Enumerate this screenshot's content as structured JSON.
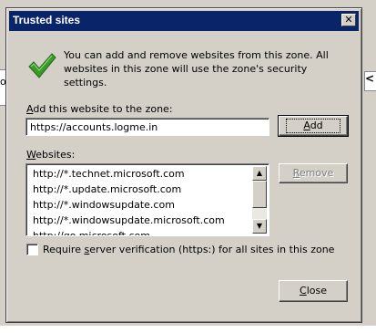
{
  "background": {
    "left_fragment": "o",
    "right_fragment": "<"
  },
  "dialog": {
    "title": "Trusted sites",
    "close_glyph": "✕",
    "intro_text": "You can add and remove websites from this zone. All websites in this zone will use the zone's security settings.",
    "add_label_prefix": "",
    "add_label_key": "A",
    "add_label_rest": "dd this website to the zone:",
    "add_input_value": "https://accounts.logme.in",
    "add_button_key": "A",
    "add_button_rest": "dd",
    "websites_label_key": "W",
    "websites_label_rest": "ebsites:",
    "websites": [
      "http://*.technet.microsoft.com",
      "http://*.update.microsoft.com",
      "http://*.windowsupdate.com",
      "http://*.windowsupdate.microsoft.com",
      "http://go.microsoft.com"
    ],
    "remove_button_key": "R",
    "remove_button_rest": "emove",
    "require_prefix": "Require ",
    "require_key": "s",
    "require_rest": "erver verification (https:) for all sites in this zone",
    "require_checked": false,
    "close_button_key": "C",
    "close_button_rest": "lose"
  },
  "icons": {
    "check": "check-icon",
    "scroll_up": "scroll-up-icon",
    "scroll_down": "scroll-down-icon"
  },
  "colors": {
    "titlebar": "#0a246a",
    "check_green": "#3a9a2a",
    "face": "#d4d0c8"
  }
}
